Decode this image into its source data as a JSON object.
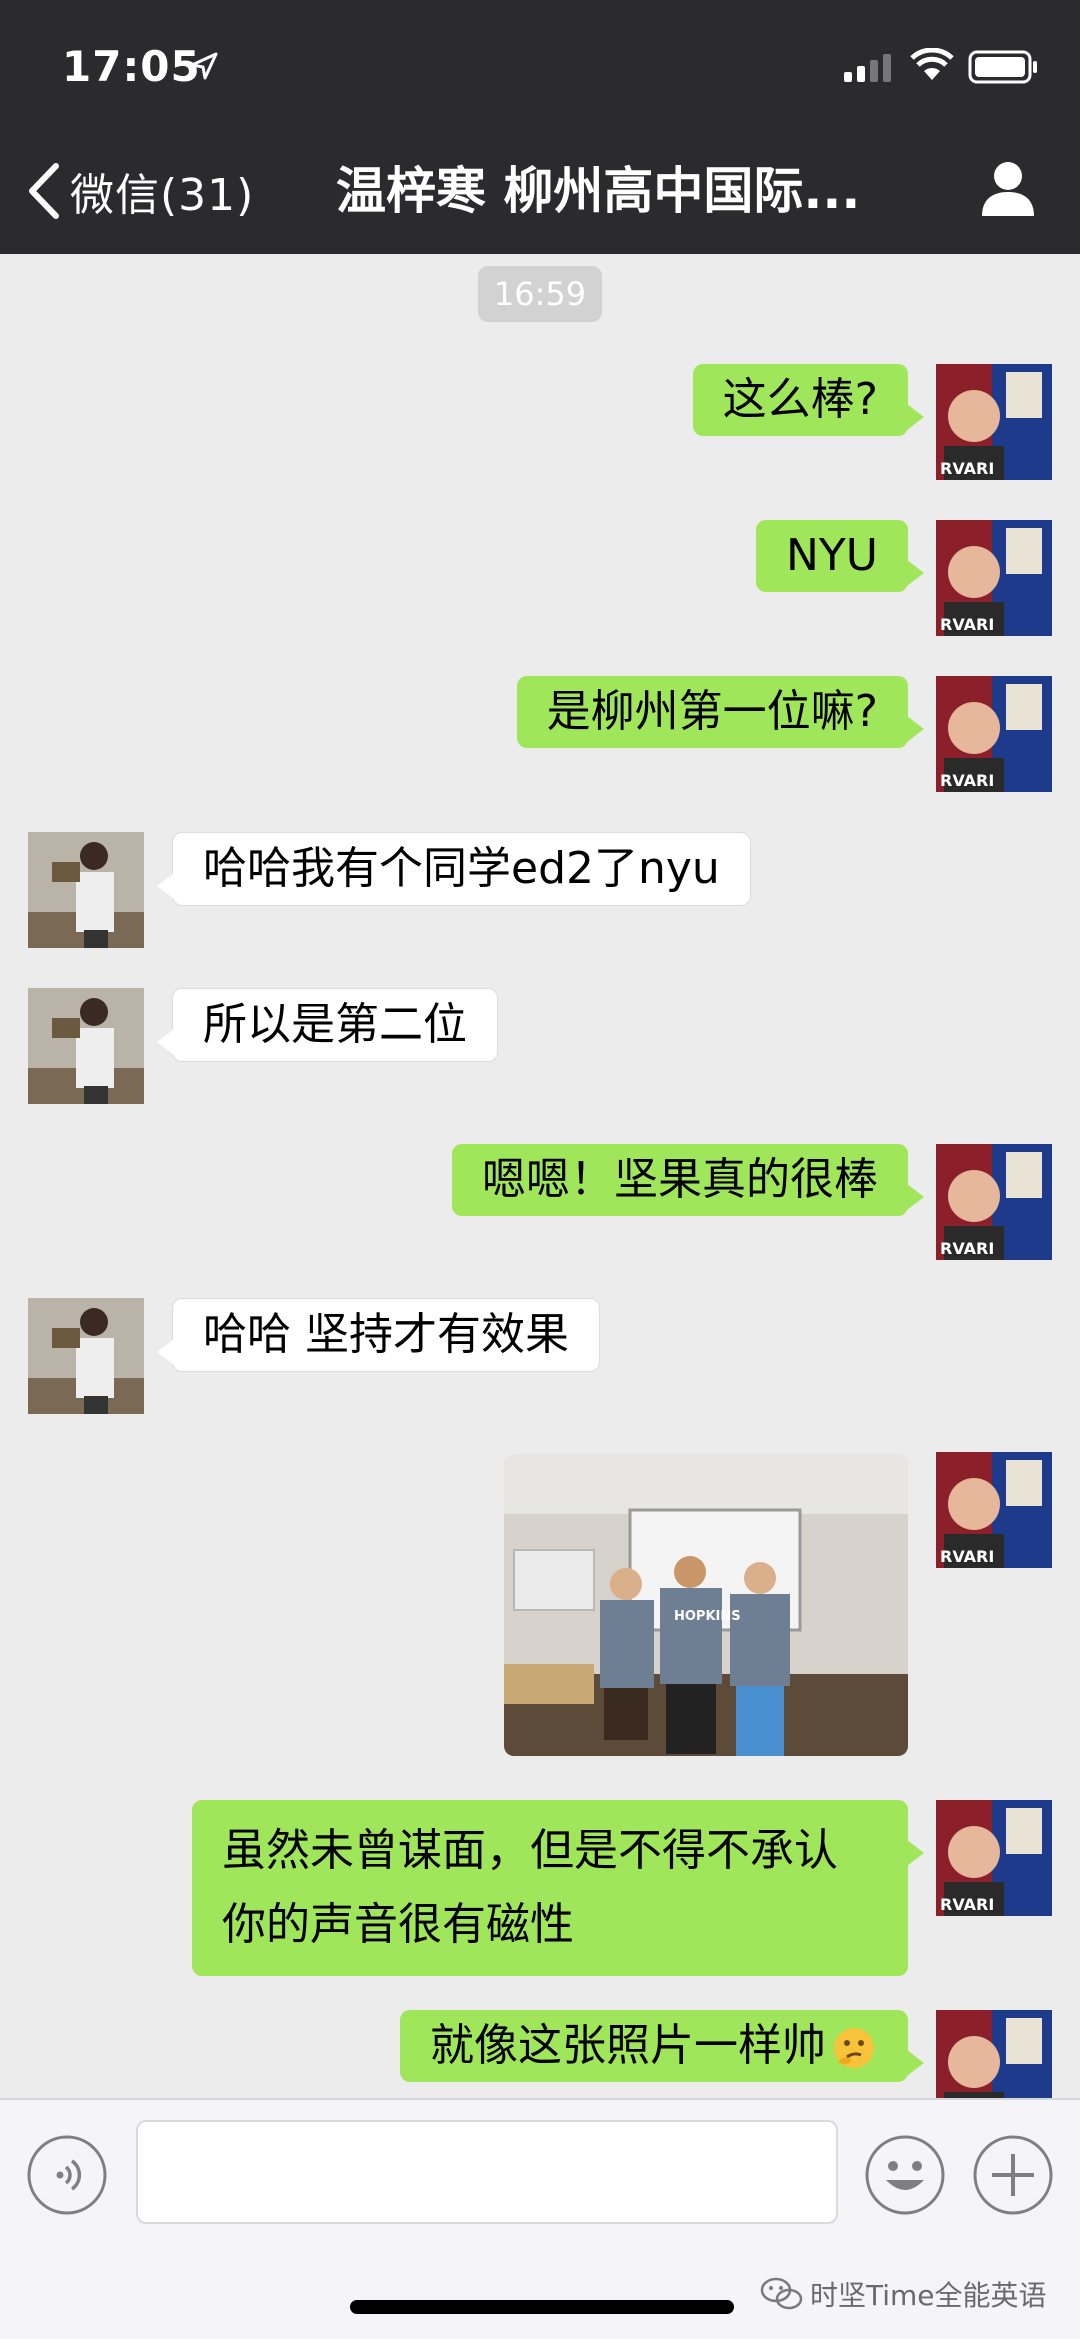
{
  "status_bar": {
    "time": "17:05"
  },
  "nav": {
    "back_label": "微信(31)",
    "title": "温梓寒 柳州高中国际..."
  },
  "timestamp": "16:59",
  "messages": [
    {
      "from": "me",
      "text": "这么棒?"
    },
    {
      "from": "me",
      "text": "NYU"
    },
    {
      "from": "me",
      "text": "是柳州第一位嘛?"
    },
    {
      "from": "other",
      "text": "哈哈我有个同学ed2了nyu"
    },
    {
      "from": "other",
      "text": "所以是第二位"
    },
    {
      "from": "me",
      "text": "嗯嗯！坚果真的很棒"
    },
    {
      "from": "other",
      "text": "哈哈 坚持才有效果"
    },
    {
      "from": "me",
      "type": "image",
      "text": "HOPKINS"
    },
    {
      "from": "me",
      "text": "虽然未曾谋面，但是不得不承认你的声音很有磁性"
    },
    {
      "from": "me",
      "text": "就像这张照片一样帅",
      "emoji": "thinking-face"
    }
  ],
  "input": {
    "placeholder": ""
  },
  "watermark": "时坚Time全能英语",
  "colors": {
    "header_bg": "#2b2b2d",
    "chat_bg": "#ececec",
    "bubble_me": "#a0e65a",
    "bubble_other": "#ffffff"
  },
  "icons": [
    "location-arrow-icon",
    "signal-icon",
    "wifi-icon",
    "battery-icon",
    "back-chevron-icon",
    "profile-icon",
    "voice-icon",
    "emoji-icon",
    "plus-icon",
    "wechat-logo-icon"
  ]
}
